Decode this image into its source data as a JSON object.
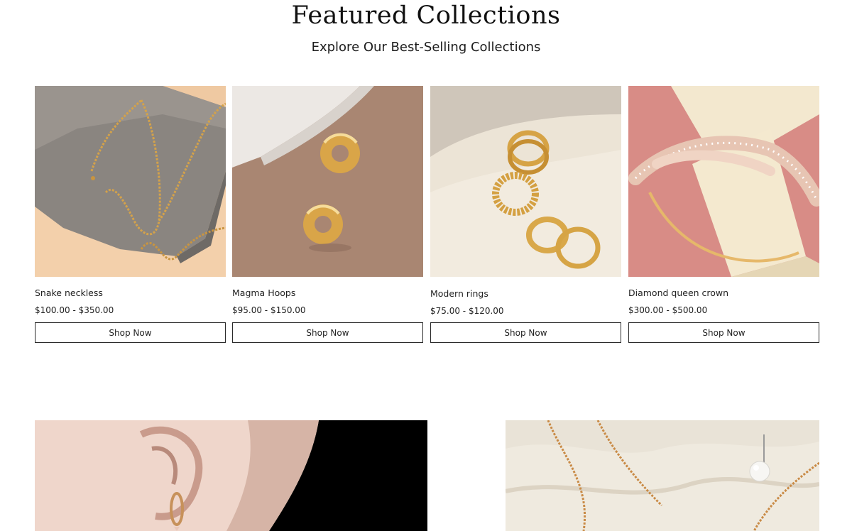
{
  "header": {
    "title": "Featured Collections",
    "subtitle": "Explore Our Best-Selling Collections"
  },
  "products": [
    {
      "name": "Snake neckless",
      "price": "$100.00 - $350.00",
      "cta": "Shop Now",
      "image_icon": "chain-necklace-photo"
    },
    {
      "name": "Magma Hoops",
      "price": "$95.00 - $150.00",
      "cta": "Shop Now",
      "image_icon": "gold-hoop-earrings-photo"
    },
    {
      "name": "Modern rings",
      "price": "$75.00 - $120.00",
      "cta": "Shop Now",
      "image_icon": "stacked-gold-rings-photo"
    },
    {
      "name": "Diamond queen crown",
      "price": "$300.00 - $500.00",
      "cta": "Shop Now",
      "image_icon": "tiara-crown-photo"
    }
  ],
  "banners": [
    {
      "image_icon": "model-earring-photo"
    },
    {
      "image_icon": "pearl-chain-photo"
    }
  ],
  "colors": {
    "text": "#111111",
    "button_border": "#2a2a2a",
    "background": "#ffffff"
  }
}
